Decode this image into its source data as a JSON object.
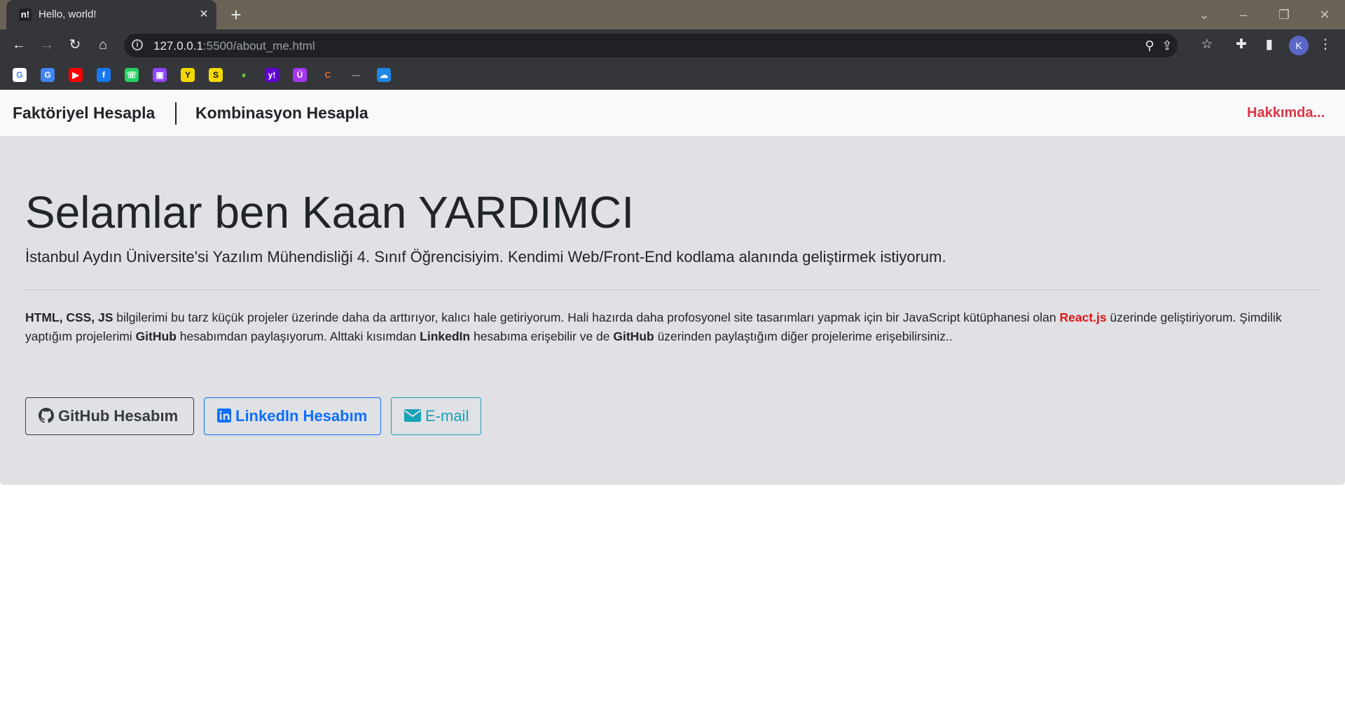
{
  "browser": {
    "tab": {
      "favicon_text": "n!",
      "title": "Hello, world!"
    },
    "address": {
      "host": "127.0.0.1",
      "rest": ":5500/about_me.html"
    },
    "profile_initial": "K",
    "bookmarks": [
      {
        "name": "google",
        "label": "G",
        "color": "#ffffff",
        "fg": "#4285f4"
      },
      {
        "name": "translate",
        "label": "G",
        "color": "#4285f4",
        "fg": "#ffffff"
      },
      {
        "name": "youtube",
        "label": "▶",
        "color": "#ff0000",
        "fg": "#ffffff"
      },
      {
        "name": "facebook",
        "label": "f",
        "color": "#1877f2",
        "fg": "#ffffff"
      },
      {
        "name": "whatsapp",
        "label": "☏",
        "color": "#25d366",
        "fg": "#ffffff"
      },
      {
        "name": "twitch",
        "label": "▣",
        "color": "#9146ff",
        "fg": "#ffffff"
      },
      {
        "name": "app-y",
        "label": "Y",
        "color": "#f4d800",
        "fg": "#111111"
      },
      {
        "name": "app-s",
        "label": "S",
        "color": "#f4d800",
        "fg": "#111111"
      },
      {
        "name": "drop",
        "label": "●",
        "color": "#35363a",
        "fg": "#6cc04a"
      },
      {
        "name": "yahoo",
        "label": "y!",
        "color": "#6001d2",
        "fg": "#ffffff"
      },
      {
        "name": "app-u",
        "label": "Ü",
        "color": "#a435f0",
        "fg": "#ffffff"
      },
      {
        "name": "app-c",
        "label": "C",
        "color": "#35363a",
        "fg": "#f06529"
      },
      {
        "name": "dash",
        "label": "—",
        "color": "#35363a",
        "fg": "#9aa0a6"
      },
      {
        "name": "cloud",
        "label": "☁",
        "color": "#1e88e5",
        "fg": "#ffffff"
      }
    ]
  },
  "nav": {
    "brand": "Faktöriyel Hesapla",
    "link": "Kombinasyon Hesapla",
    "about": "Hakkımda..."
  },
  "hero": {
    "title": "Selamlar ben Kaan YARDIMCI",
    "lead": "İstanbul Aydın Üniversite'si Yazılım Mühendisliği 4. Sınıf Öğrencisiyim. Kendimi Web/Front-End kodlama alanında geliştirmek istiyorum.",
    "paragraph": {
      "p1_bold": "HTML, CSS, JS",
      "p1": " bilgilerimi bu tarz küçük projeler üzerinde daha da arttırıyor, kalıcı hale getiriyorum. Hali hazırda daha profosyonel site tasarımları yapmak için bir JavaScript kütüphanesi olan ",
      "react": "React.js",
      "p2": " üzerinde geliştiriyorum. Şimdilik yaptığım projelerimi ",
      "github1": "GitHub",
      "p3": " hesabımdan paylaşıyorum. Alttaki kısımdan ",
      "linkedin": "LinkedIn",
      "p4": " hesabıma erişebilir ve de ",
      "github2": "GitHub",
      "p5": " üzerinden paylaştığım diğer projelerime erişebilirsiniz.."
    },
    "buttons": {
      "github": "GitHub Hesabım",
      "linkedin": "LinkedIn Hesabım",
      "email": "E-mail"
    }
  }
}
